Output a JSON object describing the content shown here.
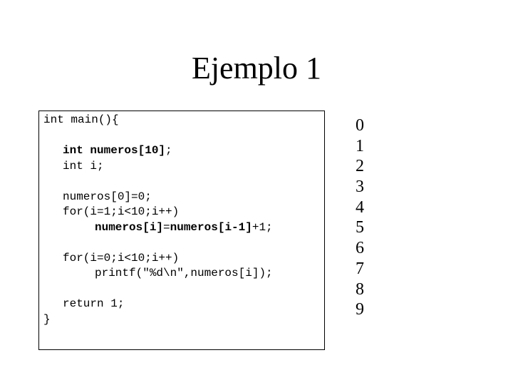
{
  "slide": {
    "title": "Ejemplo 1"
  },
  "code": {
    "lines": [
      {
        "indent": 0,
        "segments": [
          {
            "text": "int main(){",
            "bold": false
          }
        ]
      },
      {
        "indent": 0,
        "segments": []
      },
      {
        "indent": 1,
        "segments": [
          {
            "text": "int numeros[10]",
            "bold": true
          },
          {
            "text": ";",
            "bold": false
          }
        ]
      },
      {
        "indent": 1,
        "segments": [
          {
            "text": "int i;",
            "bold": false
          }
        ]
      },
      {
        "indent": 0,
        "segments": []
      },
      {
        "indent": 1,
        "segments": [
          {
            "text": "numeros[0]=0;",
            "bold": false
          }
        ]
      },
      {
        "indent": 1,
        "segments": [
          {
            "text": "for(i=1;i<10;i++)",
            "bold": false
          }
        ]
      },
      {
        "indent": 2,
        "segments": [
          {
            "text": "numeros[i]",
            "bold": true
          },
          {
            "text": "=",
            "bold": false
          },
          {
            "text": "numeros[i-1]",
            "bold": true
          },
          {
            "text": "+1;",
            "bold": false
          }
        ]
      },
      {
        "indent": 0,
        "segments": []
      },
      {
        "indent": 1,
        "segments": [
          {
            "text": "for(i=0;i<10;i++)",
            "bold": false
          }
        ]
      },
      {
        "indent": 2,
        "segments": [
          {
            "text": "printf(\"%d\\n\",numeros[i]);",
            "bold": false
          }
        ]
      },
      {
        "indent": 0,
        "segments": []
      },
      {
        "indent": 1,
        "segments": [
          {
            "text": "return 1;",
            "bold": false
          }
        ]
      },
      {
        "indent": 0,
        "segments": [
          {
            "text": "}",
            "bold": false
          }
        ]
      }
    ]
  },
  "output": {
    "values": [
      "0",
      "1",
      "2",
      "3",
      "4",
      "5",
      "6",
      "7",
      "8",
      "9"
    ]
  }
}
